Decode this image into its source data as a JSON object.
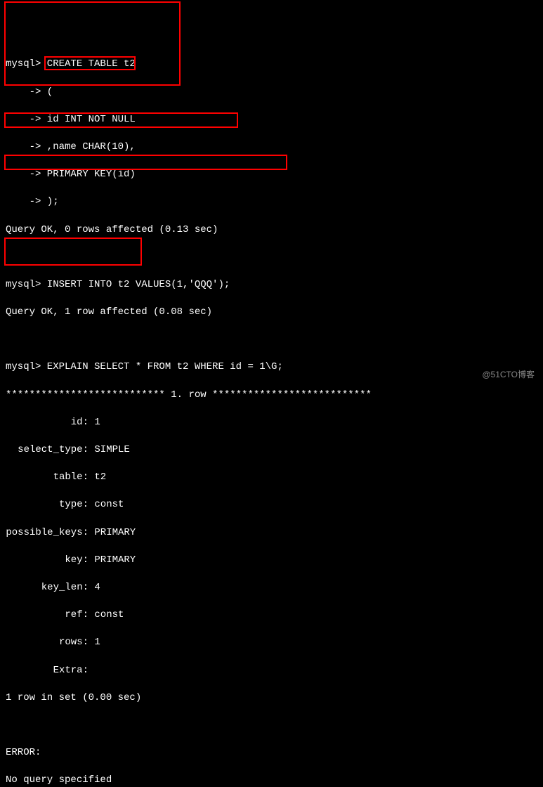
{
  "lines": {
    "l1": "mysql> CREATE TABLE t2",
    "l2": "    -> (",
    "l3": "    -> id INT NOT NULL",
    "l4": "    -> ,name CHAR(10),",
    "l5": "    -> PRIMARY KEY(id)",
    "l6": "    -> );",
    "l7": "Query OK, 0 rows affected (0.13 sec)",
    "l8": "",
    "l9": "mysql> INSERT INTO t2 VALUES(1,'QQQ');",
    "l10": "Query OK, 1 row affected (0.08 sec)",
    "l11": "",
    "l12": "mysql> EXPLAIN SELECT * FROM t2 WHERE id = 1\\G;",
    "l13": "*************************** 1. row ***************************"
  },
  "explain": {
    "id_label": "id:",
    "id_value": " 1",
    "select_type_label": "select_type:",
    "select_type_value": " SIMPLE",
    "table_label": "table:",
    "table_value": " t2",
    "type_label": "type:",
    "type_value": " const",
    "possible_keys_label": "possible_keys:",
    "possible_keys_value": " PRIMARY",
    "key_label": "key:",
    "key_value": " PRIMARY",
    "key_len_label": "key_len:",
    "key_len_value": " 4",
    "ref_label": "ref:",
    "ref_value": " const",
    "rows_label": "rows:",
    "rows_value": " 1",
    "extra_label": "Extra:",
    "extra_value": " "
  },
  "footer": {
    "rowset": "1 row in set (0.00 sec)",
    "blank": "",
    "error": "ERROR:",
    "noquery": "No query specified"
  },
  "watermark": "@51CTO博客"
}
